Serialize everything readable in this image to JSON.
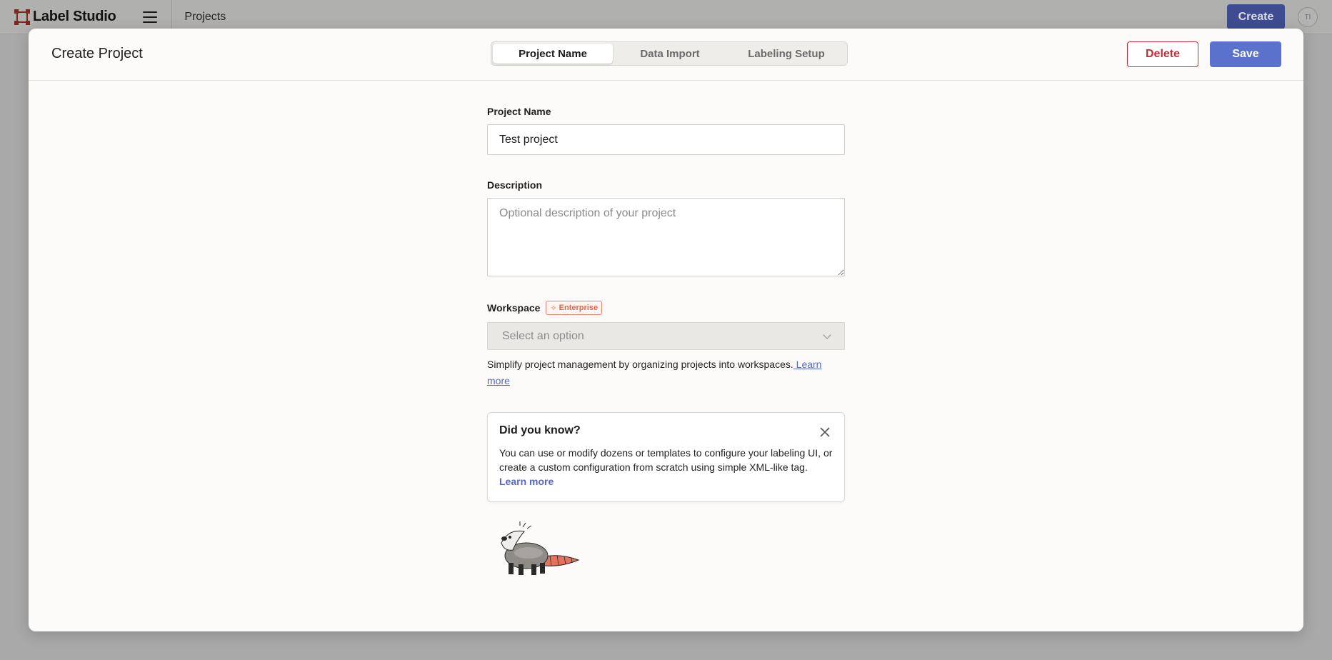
{
  "app": {
    "brand": "Label Studio",
    "breadcrumb": "Projects",
    "create_label": "Create",
    "avatar_initials": "TI"
  },
  "modal": {
    "title": "Create Project",
    "tabs": [
      {
        "label": "Project Name",
        "active": true
      },
      {
        "label": "Data Import",
        "active": false
      },
      {
        "label": "Labeling Setup",
        "active": false
      }
    ],
    "delete_label": "Delete",
    "save_label": "Save"
  },
  "form": {
    "name_label": "Project Name",
    "name_value": "Test project",
    "description_label": "Description",
    "description_placeholder": "Optional description of your project",
    "workspace_label": "Workspace",
    "enterprise_badge": "Enterprise",
    "workspace_placeholder": "Select an option",
    "workspace_help": "Simplify project management by organizing projects into workspaces.",
    "workspace_learn_more": " Learn more"
  },
  "tip": {
    "title": "Did you know?",
    "body": "You can use or modify dozens or templates to configure your labeling UI, or create a custom configuration from scratch using simple XML-like tag.",
    "learn_more": "Learn more"
  },
  "colors": {
    "accent": "#5a72cc",
    "danger": "#c62d38",
    "enterprise": "#e0664f",
    "brand_red": "#e0543d"
  },
  "icons": [
    "label-studio-logo-icon",
    "hamburger-menu-icon",
    "sparkle-icon",
    "chevron-down-icon",
    "close-icon",
    "opossum-mascot-icon"
  ]
}
